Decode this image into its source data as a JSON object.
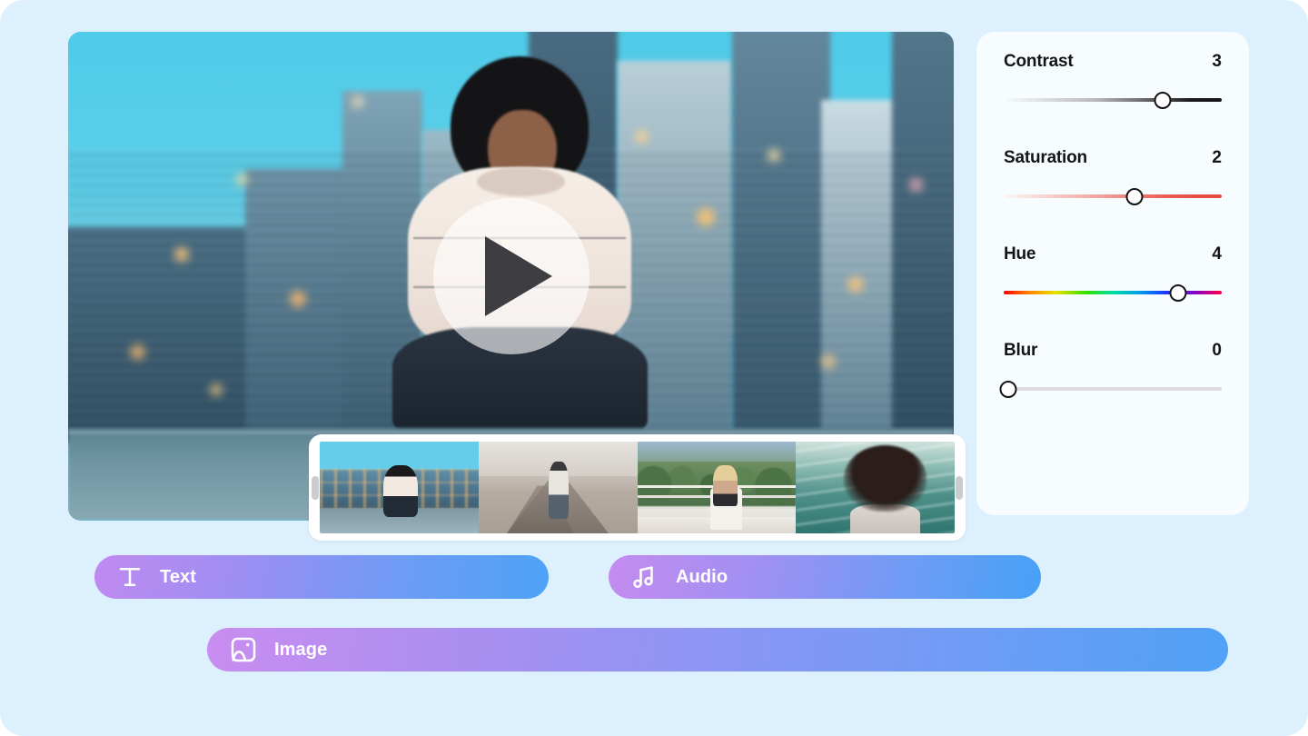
{
  "theme": {
    "page_background": "#ddf0fd",
    "panel_background": "#f7fcff",
    "text_color": "#141414",
    "button_gradient_start": "#c08af0",
    "button_gradient_end": "#4da2f7"
  },
  "player": {
    "play_button_label": "Play",
    "play_icon": "play-triangle-icon",
    "overlay_opacity": "0.62"
  },
  "timeline": {
    "left_handle_name": "trim-handle-left",
    "right_handle_name": "trim-handle-right",
    "clips": [
      {
        "name": "clip-1",
        "description": "Woman sitting cross-legged on rooftop with city skyline"
      },
      {
        "name": "clip-2",
        "description": "Woman standing on railroad tracks in desert"
      },
      {
        "name": "clip-3",
        "description": "Woman seated on chair on balcony overlooking hills"
      },
      {
        "name": "clip-4",
        "description": "Woman with hair blowing in front of ocean waves"
      }
    ]
  },
  "adjustments": {
    "controls": [
      {
        "name": "contrast",
        "label": "Contrast",
        "value": "3",
        "percent": 73,
        "track": "grayscale-gradient"
      },
      {
        "name": "saturation",
        "label": "Saturation",
        "value": "2",
        "percent": 60,
        "track": "red-gradient"
      },
      {
        "name": "hue",
        "label": "Hue",
        "value": "4",
        "percent": 80,
        "track": "rainbow-gradient"
      },
      {
        "name": "blur",
        "label": "Blur",
        "value": "0",
        "percent": 0,
        "track": "plain-gray"
      }
    ]
  },
  "actions": [
    {
      "name": "text",
      "label": "Text",
      "icon": "text-t-icon"
    },
    {
      "name": "audio",
      "label": "Audio",
      "icon": "music-note-icon"
    },
    {
      "name": "image",
      "label": "Image",
      "icon": "picture-icon"
    }
  ]
}
